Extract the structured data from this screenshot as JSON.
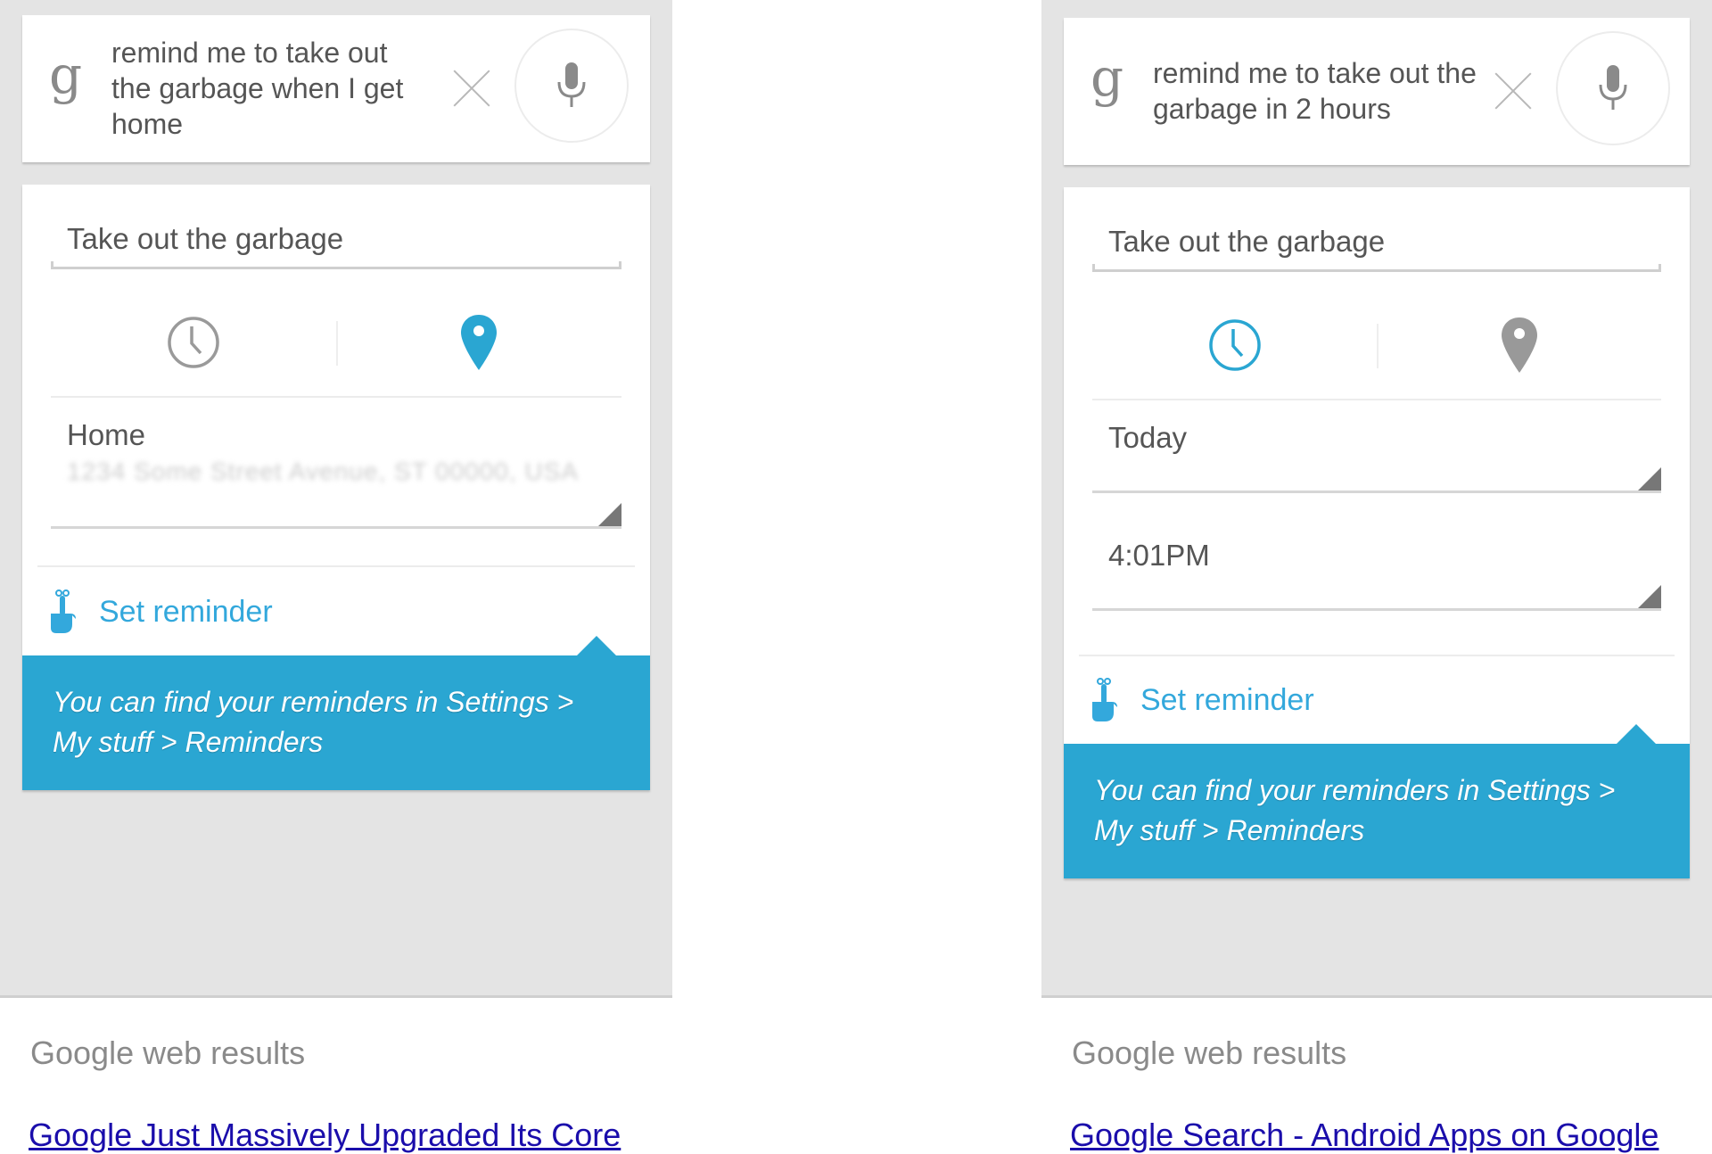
{
  "colors": {
    "accent_blue": "#2aa6d2",
    "link_blue": "#1a0dab",
    "panel_grey": "#e4e4e4",
    "icon_grey": "#999999"
  },
  "screens": [
    {
      "search": {
        "logo": "g",
        "query": "remind me to take out the garbage when I get home",
        "clear_icon": "close-icon",
        "mic_icon": "microphone-icon"
      },
      "reminder": {
        "title": "Take out the garbage",
        "active_mode": "location",
        "modes": [
          {
            "name": "time",
            "icon": "clock-icon",
            "active": false
          },
          {
            "name": "location",
            "icon": "location-pin-icon",
            "active": true
          }
        ],
        "location_label": "Home",
        "location_address": "(address blurred)",
        "set_reminder_label": "Set reminder",
        "tip": "You can find your reminders in Settings > My stuff > Reminders"
      },
      "web_results_header": "Google web results",
      "first_result": "Google Just Massively Upgraded Its Core"
    },
    {
      "search": {
        "logo": "g",
        "query": "remind me to take out the garbage in 2 hours",
        "clear_icon": "close-icon",
        "mic_icon": "microphone-icon"
      },
      "reminder": {
        "title": "Take out the garbage",
        "active_mode": "time",
        "modes": [
          {
            "name": "time",
            "icon": "clock-icon",
            "active": true
          },
          {
            "name": "location",
            "icon": "location-pin-icon",
            "active": false
          }
        ],
        "date_value": "Today",
        "time_value": "4:01PM",
        "set_reminder_label": "Set reminder",
        "tip": "You can find your reminders in Settings > My stuff > Reminders"
      },
      "web_results_header": "Google web results",
      "first_result": "Google Search - Android Apps on Google"
    }
  ]
}
